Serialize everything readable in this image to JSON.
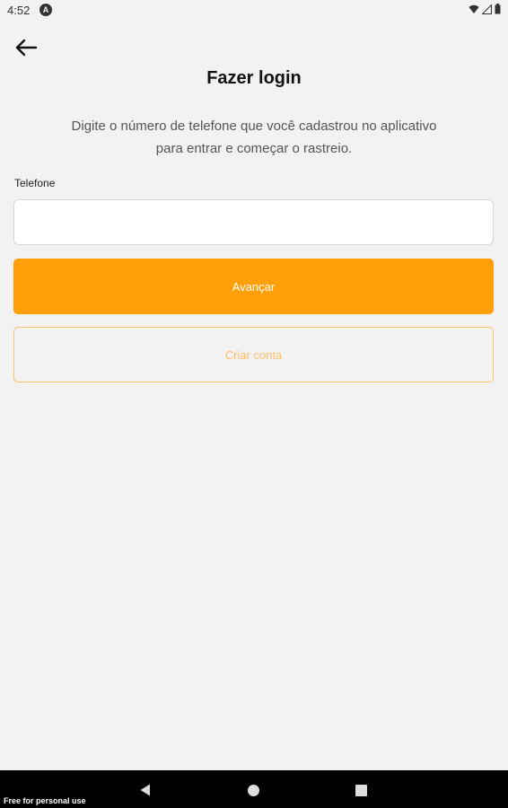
{
  "status_bar": {
    "time": "4:52",
    "app_icon": "A"
  },
  "header": {
    "back_icon": "arrow-left",
    "title": "Fazer login"
  },
  "description": {
    "line1": "Digite o número de telefone que você cadastrou no aplicativo",
    "line2": "para entrar e começar o rastreio."
  },
  "phone_field": {
    "label": "Telefone",
    "value": "",
    "placeholder": ""
  },
  "buttons": {
    "next_label": "Avançar",
    "create_account_label": "Criar conta"
  },
  "nav_bar": {
    "watermark": "Free for personal use"
  },
  "colors": {
    "accent": "#ff9f0a",
    "accent_light": "#ffc266",
    "background": "#f2f2f2"
  }
}
